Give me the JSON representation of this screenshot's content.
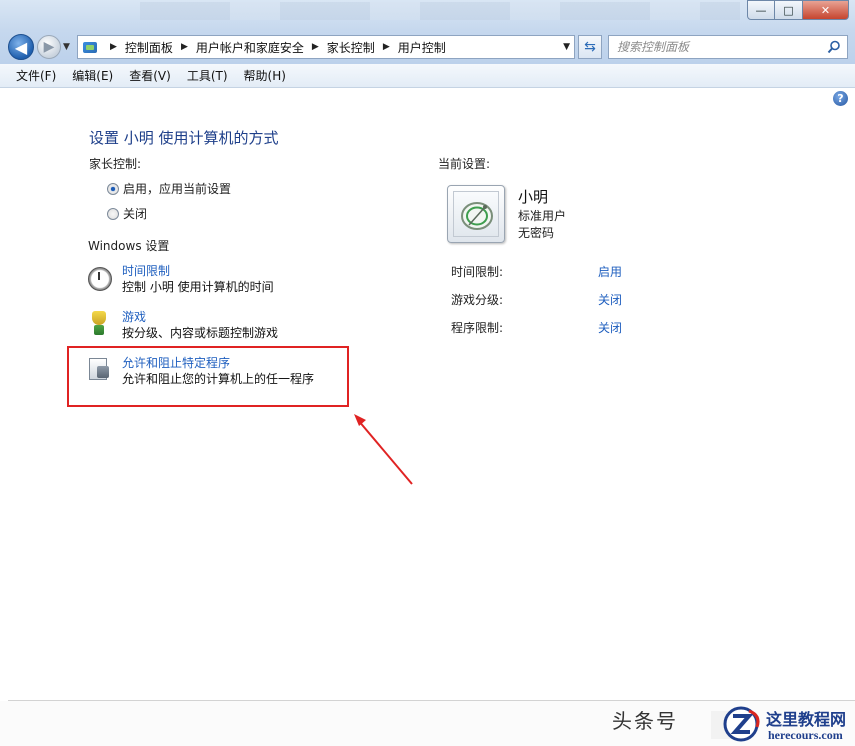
{
  "window": {
    "minimize_glyph": "—",
    "maximize_glyph": "□",
    "close_glyph": "✕"
  },
  "address": {
    "breadcrumbs": [
      "控制面板",
      "用户帐户和家庭安全",
      "家长控制",
      "用户控制"
    ],
    "separator": "▶",
    "dropdown_glyph": "▼"
  },
  "search": {
    "placeholder": "搜索控制面板"
  },
  "menu": [
    "文件(F)",
    "编辑(E)",
    "查看(V)",
    "工具(T)",
    "帮助(H)"
  ],
  "main": {
    "title": "设置 小明 使用计算机的方式",
    "parental_label": "家长控制:",
    "radio_on": "启用，应用当前设置",
    "radio_off": "关闭",
    "windows_settings_label": "Windows 设置",
    "settings": [
      {
        "link": "时间限制",
        "desc": "控制 小明 使用计算机的时间",
        "icon": "clock-icon"
      },
      {
        "link": "游戏",
        "desc": "按分级、内容或标题控制游戏",
        "icon": "games-icon"
      },
      {
        "link": "允许和阻止特定程序",
        "desc": "允许和阻止您的计算机上的任一程序",
        "icon": "programs-icon"
      }
    ]
  },
  "current": {
    "label": "当前设置:",
    "user_name": "小明",
    "account_type": "标准用户",
    "password_status": "无密码",
    "rows": [
      {
        "label": "时间限制:",
        "value": "启用"
      },
      {
        "label": "游戏分级:",
        "value": "关闭"
      },
      {
        "label": "程序限制:",
        "value": "关闭"
      }
    ]
  },
  "help_glyph": "?",
  "watermark": {
    "left_text": "头条号",
    "site_title": "这里教程网",
    "site_url": "herecours.com"
  },
  "colors": {
    "link": "#1f5fbf",
    "title": "#1e3f8a",
    "highlight": "#e02323"
  }
}
